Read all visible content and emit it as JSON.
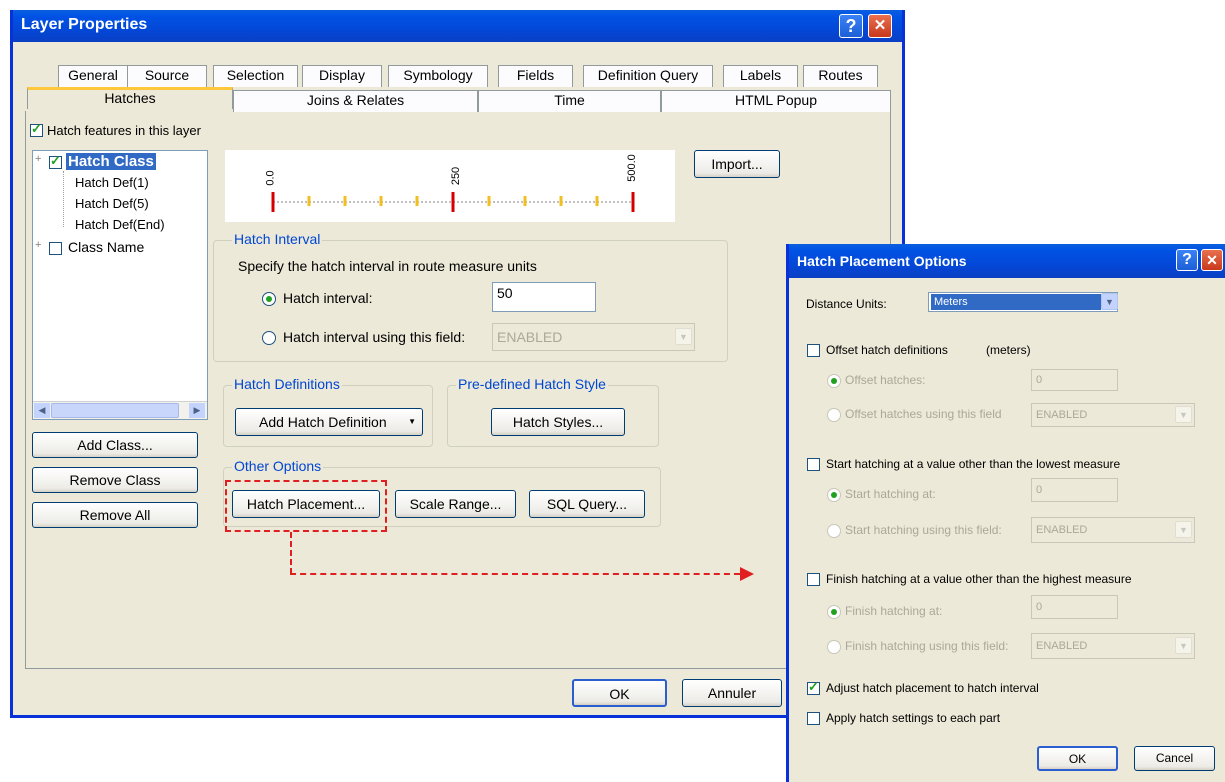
{
  "main": {
    "title": "Layer Properties",
    "tabs_row1": [
      "General",
      "Source",
      "Selection",
      "Display",
      "Symbology",
      "Fields",
      "Definition Query",
      "Labels",
      "Routes"
    ],
    "tabs_row2": [
      "Hatches",
      "Joins & Relates",
      "Time",
      "HTML Popup"
    ],
    "hatch_features_label": "Hatch features in this layer",
    "tree": {
      "items": [
        "Hatch Class",
        "Hatch Def(1)",
        "Hatch Def(5)",
        "Hatch Def(End)",
        "Class Name"
      ]
    },
    "scale_labels": [
      "0.0",
      "250",
      "500.0"
    ],
    "import_btn": "Import...",
    "interval_group": "Hatch Interval",
    "interval_desc": "Specify the hatch interval in route measure units",
    "interval_radio": "Hatch interval:",
    "interval_value": "50",
    "interval_field_radio": "Hatch interval using this field:",
    "interval_field_value": "ENABLED",
    "defs_group": "Hatch Definitions",
    "add_def_btn": "Add Hatch Definition",
    "style_group": "Pre-defined Hatch Style",
    "styles_btn": "Hatch Styles...",
    "other_group": "Other Options",
    "placement_btn": "Hatch Placement...",
    "scale_btn": "Scale Range...",
    "sql_btn": "SQL Query...",
    "add_class_btn": "Add Class...",
    "remove_class_btn": "Remove Class",
    "remove_all_btn": "Remove All",
    "ok_btn": "OK",
    "cancel_btn": "Annuler"
  },
  "popup": {
    "title": "Hatch Placement Options",
    "units_label": "Distance Units:",
    "units_value": "Meters",
    "offset_check": "Offset hatch definitions",
    "offset_unit": "(meters)",
    "offset_radio1": "Offset hatches:",
    "offset_value": "0",
    "offset_radio2": "Offset hatches using this field",
    "offset_field": "ENABLED",
    "start_check": "Start hatching at a value other than the lowest measure",
    "start_radio1": "Start hatching at:",
    "start_value": "0",
    "start_radio2": "Start hatching using this field:",
    "start_field": "ENABLED",
    "finish_check": "Finish hatching at a value other than the highest measure",
    "finish_radio1": "Finish hatching at:",
    "finish_value": "0",
    "finish_radio2": "Finish hatching using this field:",
    "finish_field": "ENABLED",
    "adjust_check": "Adjust hatch placement to hatch interval",
    "apply_check": "Apply hatch settings to each part",
    "ok_btn": "OK",
    "cancel_btn": "Cancel"
  },
  "icons": {
    "help": "?",
    "close": "✕",
    "dropdown": "▼",
    "left": "◀",
    "right": "▶",
    "expand": "+"
  },
  "colors": {
    "title_bar": "#0052e4",
    "hatch_major": "#d40000",
    "hatch_minor": "#f0c020",
    "callout": "#e02020"
  }
}
